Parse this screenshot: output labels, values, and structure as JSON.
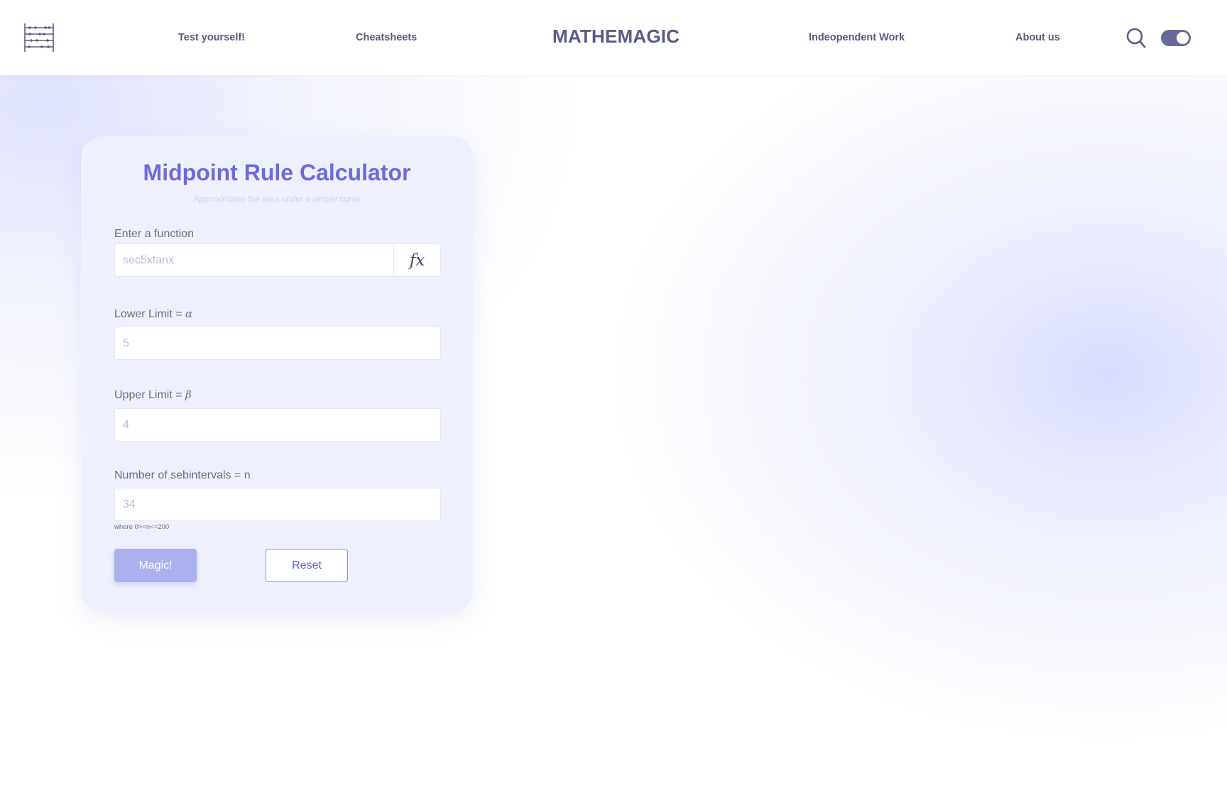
{
  "header": {
    "logo_icon": "abacus-icon",
    "nav": {
      "test_yourself": "Test yourself!",
      "cheatsheets": "Cheatsheets",
      "independent_work": "Indeopendent Work",
      "about_us": "About us"
    },
    "brand": "MATHEMAGIC",
    "search_icon": "search-icon",
    "theme_toggle_icon": "toggle-icon"
  },
  "calculator": {
    "title": "Midpoint Rule Calculator",
    "subtitle": "Approximates the area under a simple curve",
    "function": {
      "label": "Enter a function",
      "placeholder": "sec5xtanx",
      "fx_label": "fx"
    },
    "lower_limit": {
      "label": "Lower Limit = ",
      "symbol": "α",
      "placeholder": "5"
    },
    "upper_limit": {
      "label": "Upper Limit = ",
      "symbol": "β",
      "placeholder": "4"
    },
    "subintervals": {
      "label": "Number of sebintervals = n",
      "placeholder": "34",
      "hint": "where 0>=n<=200"
    },
    "magic_button": "Magic!",
    "reset_button": "Reset"
  },
  "colors": {
    "accent": "#6c6ade",
    "nav_text": "#565a7d",
    "magic_button_bg": "#acb0ee",
    "card_bg": "#eef1fd"
  }
}
